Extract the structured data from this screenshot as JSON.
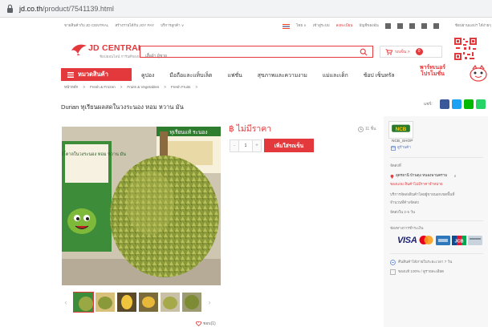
{
  "browser": {
    "url_host": "jd.co.th",
    "url_path": "/product/7541139.html"
  },
  "topstrip": {
    "left": [
      "ขายสินค้ากับ JD CENTRAL",
      "สร้างรายได้กับ JOY PAY",
      "บริการลูกค้า ∨"
    ],
    "lang": "ไทย ∨",
    "login": "เข้าสู่ระบบ",
    "register": "ลงทะเบียน",
    "my_account": "บัญชีของฉัน",
    "app": "ช้อปผ่านแอปฯ ได้ง่ายๆ"
  },
  "header": {
    "logo_main": "JD CENTRAL",
    "logo_sub": "ช้อปออนไลน์ การันตีของแท้",
    "search_placeholder": "เสื้อผ้า ผู้ชาย",
    "cart_label": "รถเข็น >",
    "cart_count": "0"
  },
  "nav": {
    "category_button": "หมวดสินค้า",
    "items": [
      "คูปอง",
      "มือถือและแท็บเล็ต",
      "แฟชั่น",
      "สุขภาพและความงาม",
      "แม่และเด็ก",
      "ช้อป เซ็นทรัล"
    ],
    "promo": [
      "พาร์ทเนอร์",
      "โปรโมชั่น"
    ]
  },
  "breadcrumb": [
    "หน้าหลัก",
    ">",
    "Fresh & Frozen",
    ">",
    "Fruits & Vegetables",
    ">",
    "Fresh Fruits",
    ">"
  ],
  "product": {
    "title": "Durian ทุเรียนผลสดในวงระนอง หอม หวาน มัน",
    "share_label": "แชร์:",
    "price": "฿ ไม่มีราคา",
    "sales_count": "11 ชิ้น",
    "qty_minus": "-",
    "qty_value": "1",
    "qty_plus": "+",
    "add_to_cart": "เพิ่มใส่รถเข็น",
    "favorite": "ชอบ(1)",
    "image_sign_top": "ทุเรียนแท้ ระนอง",
    "image_sign_small": "ทุเรียนนำ้ตาลในวงระนอง หอม หวาน มัน"
  },
  "shop": {
    "logo_text": "NCB",
    "name": "NCB_SHOP",
    "visit": "ดูร้านค้า",
    "ship_header": "จัดส่งที่",
    "ship_location": "อุดรธานี บ้านดุง หนองพานคราม",
    "ship_link": "ของแถม สินค้าไม่มีราคาจำหน่าย",
    "service1": "บริการจัดส่งสินค้าโดยผู้ขายนอกเขตพื้นที่",
    "service2": "จำนวนที่ค้างจัดส่ง",
    "delivery_time": "จัดส่งใน 2-5 วัน",
    "payment_header": "ช่องทางการชำระเงิน",
    "visa": "VISA",
    "jcb": "JCB",
    "return_policy": "คืนสินค้าได้ภายในระยะเวลา 7 วัน",
    "authentic": "ของแท้ 100% / ดูรายละเอียด"
  },
  "colors": {
    "brand_red": "#e4393c",
    "facebook": "#3b5998",
    "twitter": "#1da1f2",
    "line": "#00b900",
    "panel_bg": "#f7f7f7"
  }
}
